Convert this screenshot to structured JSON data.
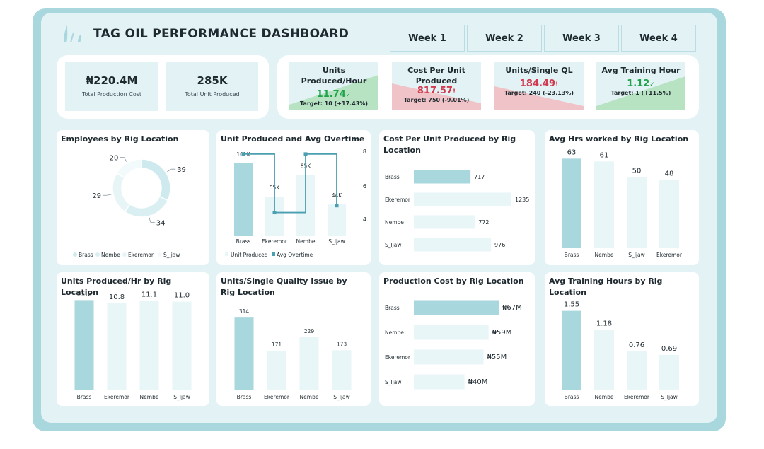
{
  "header": {
    "title": "TAG OIL PERFORMANCE DASHBOARD",
    "weeks": [
      "Week 1",
      "Week 2",
      "Week 3",
      "Week 4"
    ]
  },
  "kpis": [
    {
      "value": "₦220.4M",
      "label": "Total Production Cost"
    },
    {
      "value": "285K",
      "label": "Total Unit Produced"
    }
  ],
  "metric_kpis": [
    {
      "title": "Units Produced/Hour",
      "value": "11.74",
      "indicator": "✓",
      "target": "Target: 10 (+17.43%)",
      "status": "good"
    },
    {
      "title": "Cost Per Unit Produced",
      "value": "817.57",
      "indicator": "!",
      "target": "Target: 750 (-9.01%)",
      "status": "bad"
    },
    {
      "title": "Units/Single QL",
      "value": "184.49",
      "indicator": "!",
      "target": "Target: 240 (-23.13%)",
      "status": "bad"
    },
    {
      "title": "Avg Training Hour",
      "value": "1.12",
      "indicator": "✓",
      "target": "Target: 1 (+11.5%)",
      "status": "good"
    }
  ],
  "colors": {
    "primary": "#a9d7de",
    "light": "#e8f6f7",
    "mid": "#cfeaee",
    "good": "#1fa24a",
    "bad": "#d13a4f",
    "good_fill": "#b7e3c2",
    "bad_fill": "#efc3c7"
  },
  "chart_data": [
    {
      "id": "employees",
      "type": "pie",
      "title": "Employees by Rig Location",
      "categories": [
        "Brass",
        "Nembe",
        "Ekeremor",
        "S_Ijaw"
      ],
      "values": [
        39,
        34,
        29,
        20
      ],
      "legend": "bottom"
    },
    {
      "id": "units_overtime",
      "type": "bar",
      "title": "Unit Produced and Avg Overtime",
      "categories": [
        "Brass",
        "Ekeremor",
        "Nembe",
        "S_Ijaw"
      ],
      "series": [
        {
          "name": "Unit Produced",
          "values": [
            101,
            55,
            85,
            44
          ],
          "labels": [
            "101K",
            "55K",
            "85K",
            "44K"
          ]
        },
        {
          "name": "Avg Overtime",
          "values": [
            7.9,
            3.7,
            7.9,
            4.2
          ]
        }
      ],
      "y2_ticks": [
        "8",
        "6",
        "4"
      ],
      "legend": "bottom"
    },
    {
      "id": "cost_per_unit",
      "type": "bar",
      "title": "Cost Per Unit Produced by Rig Location",
      "orientation": "horizontal",
      "categories": [
        "Brass",
        "Ekeremor",
        "Nembe",
        "S_Ijaw"
      ],
      "values": [
        717,
        1235,
        772,
        976
      ]
    },
    {
      "id": "avg_hrs",
      "type": "bar",
      "title": "Avg Hrs worked by Rig Location",
      "categories": [
        "Brass",
        "Nembe",
        "S_Ijaw",
        "Ekeremor"
      ],
      "values": [
        63,
        61,
        50,
        48
      ]
    },
    {
      "id": "units_per_hr",
      "type": "bar",
      "title": "Units Produced/Hr by Rig Location",
      "categories": [
        "Brass",
        "Ekeremor",
        "Nembe",
        "S_Ijaw"
      ],
      "values": [
        11.2,
        10.8,
        11.1,
        11.0
      ],
      "labels": [
        "11.2",
        "10.8",
        "11.1",
        "11.0"
      ]
    },
    {
      "id": "units_quality",
      "type": "bar",
      "title": "Units/Single Quality Issue by Rig Location",
      "categories": [
        "Brass",
        "Ekeremor",
        "Nembe",
        "S_Ijaw"
      ],
      "values": [
        314,
        171,
        229,
        173
      ]
    },
    {
      "id": "production_cost",
      "type": "bar",
      "title": "Production Cost by Rig Location",
      "orientation": "horizontal",
      "categories": [
        "Brass",
        "Nembe",
        "Ekeremor",
        "S_Ijaw"
      ],
      "values": [
        67,
        59,
        55,
        40
      ],
      "labels": [
        "₦67M",
        "₦59M",
        "₦55M",
        "₦40M"
      ]
    },
    {
      "id": "training_hours",
      "type": "bar",
      "title": "Avg Training Hours by Rig Location",
      "categories": [
        "Brass",
        "Nembe",
        "Ekeremor",
        "S_Ijaw"
      ],
      "values": [
        1.55,
        1.18,
        0.76,
        0.69
      ],
      "labels": [
        "1.55",
        "1.18",
        "0.76",
        "0.69"
      ]
    }
  ]
}
